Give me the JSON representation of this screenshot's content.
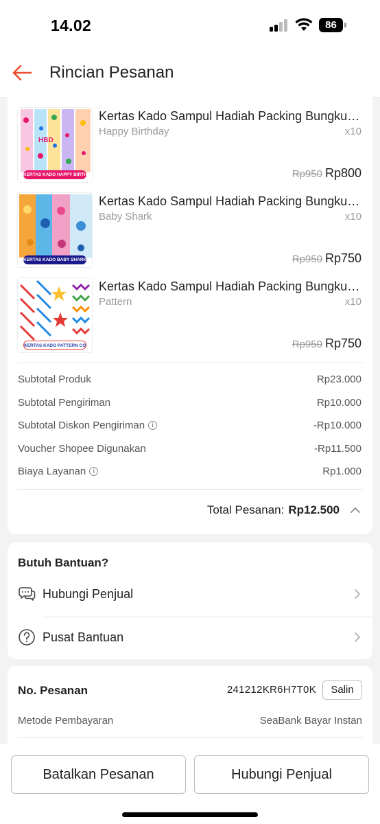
{
  "status_bar": {
    "time": "14.02",
    "battery": "86"
  },
  "header": {
    "title": "Rincian Pesanan",
    "back_icon": "arrow-left-icon",
    "accent": "#ee4d2d"
  },
  "products": [
    {
      "name": "Kertas Kado Sampul Hadiah Packing Bungkus Kado",
      "variant": "Happy Birthday",
      "qty": "x10",
      "old_price": "Rp950",
      "price": "Rp800",
      "thumb_label": "KERTAS KADO HAPPY BIRTHDAY",
      "thumb_label_color": "#e8176b"
    },
    {
      "name": "Kertas Kado Sampul Hadiah Packing Bungkus Kado",
      "variant": "Baby Shark",
      "qty": "x10",
      "old_price": "Rp950",
      "price": "Rp750",
      "thumb_label": "KERTAS KADO BABY SHARK",
      "thumb_label_color": "#1a1a8c"
    },
    {
      "name": "Kertas Kado Sampul Hadiah Packing Bungkus Kado",
      "variant": "Pattern",
      "qty": "x10",
      "old_price": "Rp950",
      "price": "Rp750",
      "thumb_label": "KERTAS KADO PATTERN COLOR",
      "thumb_label_color": "#2a3fa8"
    }
  ],
  "summary": [
    {
      "label": "Subtotal Produk",
      "value": "Rp23.000",
      "info": false
    },
    {
      "label": "Subtotal Pengiriman",
      "value": "Rp10.000",
      "info": false
    },
    {
      "label": "Subtotal Diskon Pengiriman",
      "value": "-Rp10.000",
      "info": true
    },
    {
      "label": "Voucher Shopee Digunakan",
      "value": "-Rp11.500",
      "info": false
    },
    {
      "label": "Biaya Layanan",
      "value": "Rp1.000",
      "info": true
    }
  ],
  "total": {
    "label": "Total Pesanan:",
    "value": "Rp12.500"
  },
  "help": {
    "title": "Butuh Bantuan?",
    "items": [
      {
        "label": "Hubungi Penjual",
        "icon": "chat-icon"
      },
      {
        "label": "Pusat Bantuan",
        "icon": "help-circle-icon"
      }
    ]
  },
  "order": {
    "number_label": "No. Pesanan",
    "number": "241212KR6H7T0K",
    "copy_label": "Salin",
    "payment_label": "Metode Pembayaran",
    "payment_value": "SeaBank Bayar Instan"
  },
  "actions": {
    "cancel": "Batalkan Pesanan",
    "contact": "Hubungi Penjual"
  }
}
